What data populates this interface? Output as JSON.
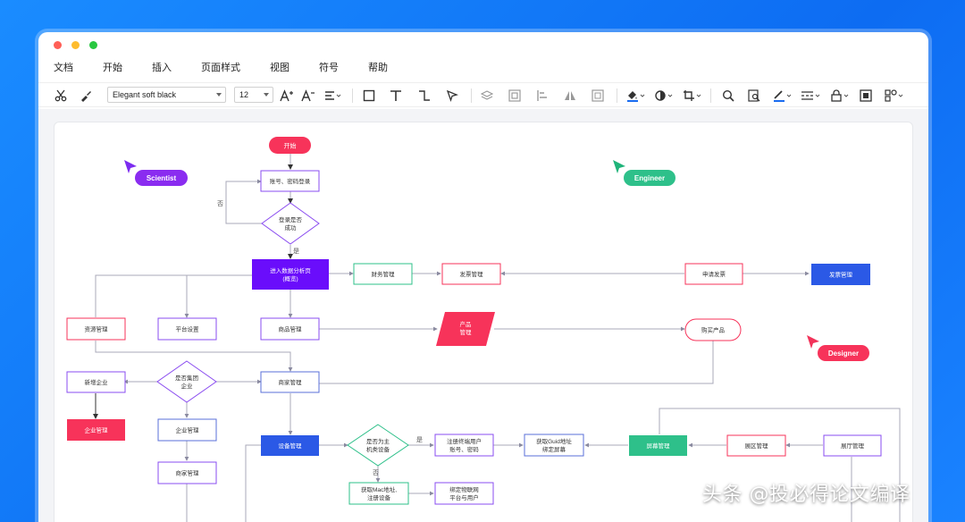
{
  "menu": {
    "items": [
      "文档",
      "开始",
      "插入",
      "页面样式",
      "视图",
      "符号",
      "帮助"
    ]
  },
  "toolbar": {
    "font_name": "Elegant soft black",
    "font_size": "12"
  },
  "flowchart": {
    "tags": {
      "scientist": "Scientist",
      "engineer": "Engineer",
      "designer": "Designer"
    },
    "nodes": {
      "start": "开始",
      "login": "账号、密码登录",
      "login_ok_1": "登录是否",
      "login_ok_2": "成功",
      "enter_1": "进入数据分析页",
      "enter_2": "(概览)",
      "finance": "财务管理",
      "invoice1": "发票管理",
      "apply_invoice": "申请发票",
      "invoice2": "发票管理",
      "resource": "资源管理",
      "platform": "平台设置",
      "goods": "商品管理",
      "product_1": "产品",
      "product_2": "管理",
      "buy": "购买产品",
      "new_company": "新增企业",
      "is_group_1": "是否集团",
      "is_group_2": "企业",
      "merchant": "商家管理",
      "company_mgr": "企业管理",
      "company_admin": "企业管理",
      "merchant2": "商家管理",
      "device": "设备管理",
      "is_host_1": "是否为主",
      "is_host_2": "机类设备",
      "register_1": "注册终端用户",
      "register_2": "账号、密码",
      "guid_1": "获取Guid地址",
      "guid_2": "绑定屏幕",
      "screen": "屏幕管理",
      "area": "展区管理",
      "hall": "展厅管理",
      "mac_1": "获取Mac地址,",
      "mac_2": "注册设备",
      "bind_1": "绑定物联网",
      "bind_2": "平台与用户"
    },
    "labels": {
      "no1": "否",
      "yes1": "是",
      "yes2": "是",
      "no2": "否"
    }
  },
  "watermark": "头条 @投必得论文编译",
  "colors": {
    "accent_purple": "#6a0dfb",
    "accent_pink": "#f7335a",
    "accent_blue": "#2b59e6",
    "accent_green": "#2ec08a",
    "window_bg": "#1a8cff"
  }
}
